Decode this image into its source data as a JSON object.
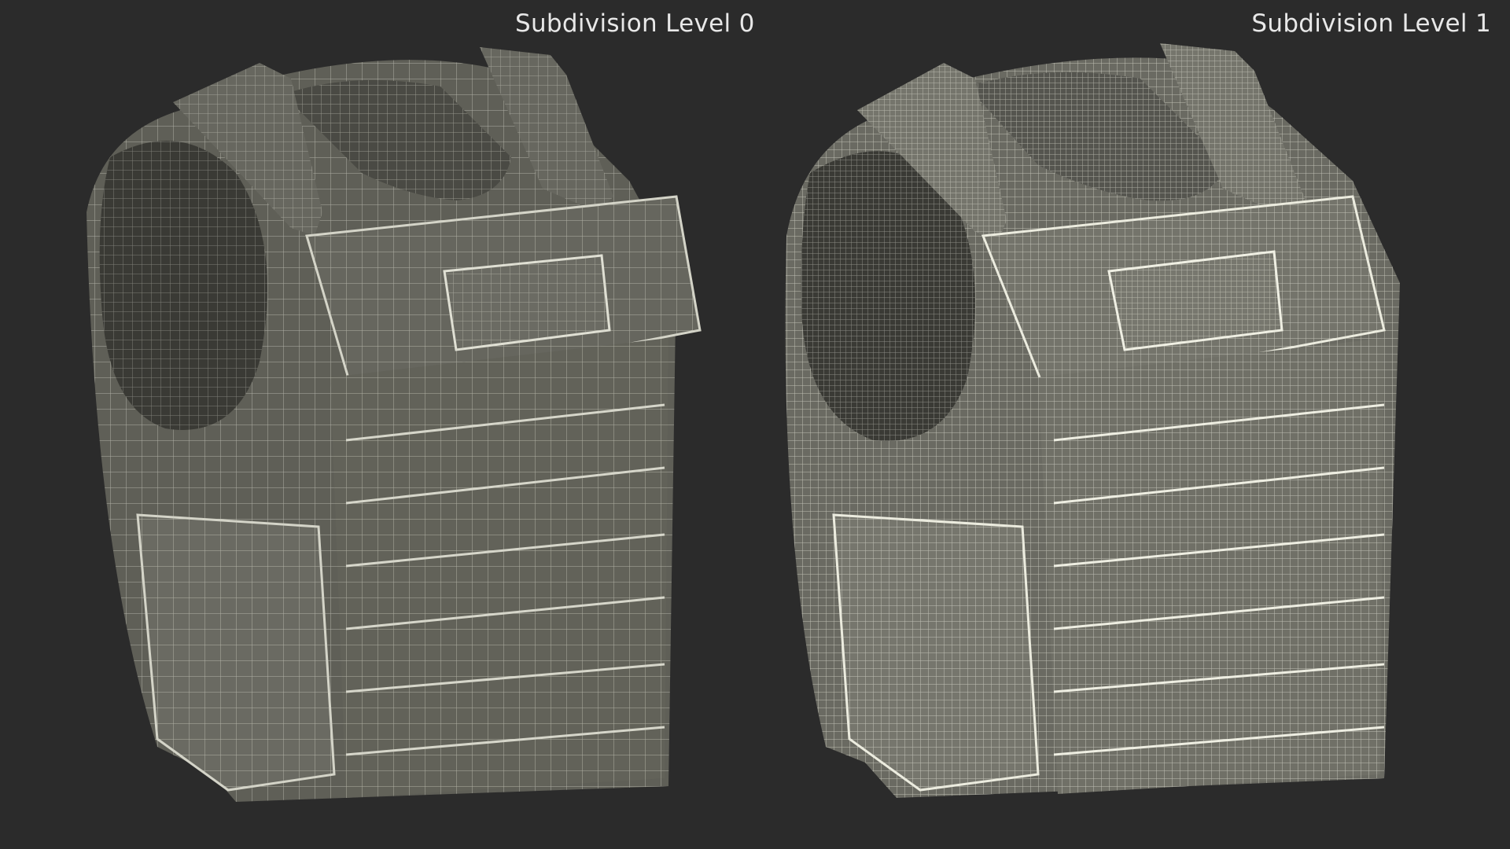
{
  "views": [
    {
      "label": "Subdivision Level 0",
      "mesh_density": "low"
    },
    {
      "label": "Subdivision Level 1",
      "mesh_density": "high"
    }
  ],
  "colors": {
    "background": "#2b2b2b",
    "vest_fill": "#5f5f57",
    "vest_shadow": "#3a3a35",
    "wire_low": "#c9c9bd",
    "wire_high": "#e2e2d6",
    "label_text": "#e8e8e8"
  }
}
